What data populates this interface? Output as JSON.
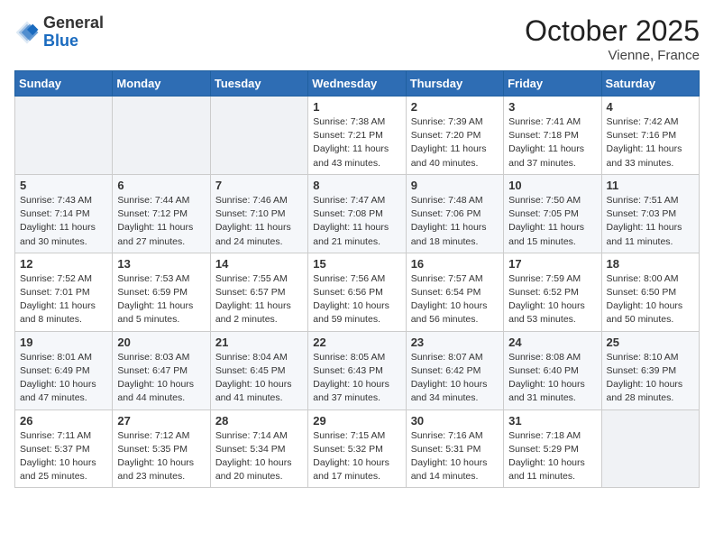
{
  "logo": {
    "general": "General",
    "blue": "Blue"
  },
  "header": {
    "month": "October 2025",
    "location": "Vienne, France"
  },
  "weekdays": [
    "Sunday",
    "Monday",
    "Tuesday",
    "Wednesday",
    "Thursday",
    "Friday",
    "Saturday"
  ],
  "weeks": [
    [
      {
        "day": "",
        "text": ""
      },
      {
        "day": "",
        "text": ""
      },
      {
        "day": "",
        "text": ""
      },
      {
        "day": "1",
        "text": "Sunrise: 7:38 AM\nSunset: 7:21 PM\nDaylight: 11 hours\nand 43 minutes."
      },
      {
        "day": "2",
        "text": "Sunrise: 7:39 AM\nSunset: 7:20 PM\nDaylight: 11 hours\nand 40 minutes."
      },
      {
        "day": "3",
        "text": "Sunrise: 7:41 AM\nSunset: 7:18 PM\nDaylight: 11 hours\nand 37 minutes."
      },
      {
        "day": "4",
        "text": "Sunrise: 7:42 AM\nSunset: 7:16 PM\nDaylight: 11 hours\nand 33 minutes."
      }
    ],
    [
      {
        "day": "5",
        "text": "Sunrise: 7:43 AM\nSunset: 7:14 PM\nDaylight: 11 hours\nand 30 minutes."
      },
      {
        "day": "6",
        "text": "Sunrise: 7:44 AM\nSunset: 7:12 PM\nDaylight: 11 hours\nand 27 minutes."
      },
      {
        "day": "7",
        "text": "Sunrise: 7:46 AM\nSunset: 7:10 PM\nDaylight: 11 hours\nand 24 minutes."
      },
      {
        "day": "8",
        "text": "Sunrise: 7:47 AM\nSunset: 7:08 PM\nDaylight: 11 hours\nand 21 minutes."
      },
      {
        "day": "9",
        "text": "Sunrise: 7:48 AM\nSunset: 7:06 PM\nDaylight: 11 hours\nand 18 minutes."
      },
      {
        "day": "10",
        "text": "Sunrise: 7:50 AM\nSunset: 7:05 PM\nDaylight: 11 hours\nand 15 minutes."
      },
      {
        "day": "11",
        "text": "Sunrise: 7:51 AM\nSunset: 7:03 PM\nDaylight: 11 hours\nand 11 minutes."
      }
    ],
    [
      {
        "day": "12",
        "text": "Sunrise: 7:52 AM\nSunset: 7:01 PM\nDaylight: 11 hours\nand 8 minutes."
      },
      {
        "day": "13",
        "text": "Sunrise: 7:53 AM\nSunset: 6:59 PM\nDaylight: 11 hours\nand 5 minutes."
      },
      {
        "day": "14",
        "text": "Sunrise: 7:55 AM\nSunset: 6:57 PM\nDaylight: 11 hours\nand 2 minutes."
      },
      {
        "day": "15",
        "text": "Sunrise: 7:56 AM\nSunset: 6:56 PM\nDaylight: 10 hours\nand 59 minutes."
      },
      {
        "day": "16",
        "text": "Sunrise: 7:57 AM\nSunset: 6:54 PM\nDaylight: 10 hours\nand 56 minutes."
      },
      {
        "day": "17",
        "text": "Sunrise: 7:59 AM\nSunset: 6:52 PM\nDaylight: 10 hours\nand 53 minutes."
      },
      {
        "day": "18",
        "text": "Sunrise: 8:00 AM\nSunset: 6:50 PM\nDaylight: 10 hours\nand 50 minutes."
      }
    ],
    [
      {
        "day": "19",
        "text": "Sunrise: 8:01 AM\nSunset: 6:49 PM\nDaylight: 10 hours\nand 47 minutes."
      },
      {
        "day": "20",
        "text": "Sunrise: 8:03 AM\nSunset: 6:47 PM\nDaylight: 10 hours\nand 44 minutes."
      },
      {
        "day": "21",
        "text": "Sunrise: 8:04 AM\nSunset: 6:45 PM\nDaylight: 10 hours\nand 41 minutes."
      },
      {
        "day": "22",
        "text": "Sunrise: 8:05 AM\nSunset: 6:43 PM\nDaylight: 10 hours\nand 37 minutes."
      },
      {
        "day": "23",
        "text": "Sunrise: 8:07 AM\nSunset: 6:42 PM\nDaylight: 10 hours\nand 34 minutes."
      },
      {
        "day": "24",
        "text": "Sunrise: 8:08 AM\nSunset: 6:40 PM\nDaylight: 10 hours\nand 31 minutes."
      },
      {
        "day": "25",
        "text": "Sunrise: 8:10 AM\nSunset: 6:39 PM\nDaylight: 10 hours\nand 28 minutes."
      }
    ],
    [
      {
        "day": "26",
        "text": "Sunrise: 7:11 AM\nSunset: 5:37 PM\nDaylight: 10 hours\nand 25 minutes."
      },
      {
        "day": "27",
        "text": "Sunrise: 7:12 AM\nSunset: 5:35 PM\nDaylight: 10 hours\nand 23 minutes."
      },
      {
        "day": "28",
        "text": "Sunrise: 7:14 AM\nSunset: 5:34 PM\nDaylight: 10 hours\nand 20 minutes."
      },
      {
        "day": "29",
        "text": "Sunrise: 7:15 AM\nSunset: 5:32 PM\nDaylight: 10 hours\nand 17 minutes."
      },
      {
        "day": "30",
        "text": "Sunrise: 7:16 AM\nSunset: 5:31 PM\nDaylight: 10 hours\nand 14 minutes."
      },
      {
        "day": "31",
        "text": "Sunrise: 7:18 AM\nSunset: 5:29 PM\nDaylight: 10 hours\nand 11 minutes."
      },
      {
        "day": "",
        "text": ""
      }
    ]
  ]
}
